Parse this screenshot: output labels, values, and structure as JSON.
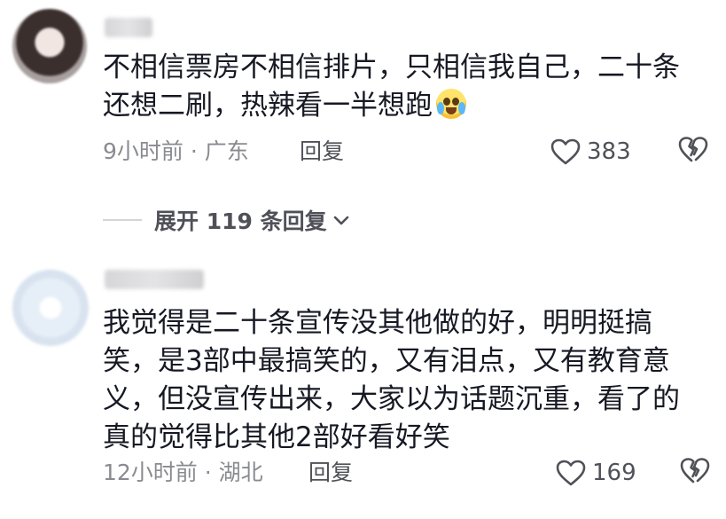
{
  "comments": [
    {
      "text": "不相信票房不相信排片，只相信我自己，二十条还想二刷，热辣看一半想跑",
      "emoji": "crying-laughing-emoji",
      "time_location": "9小时前 · 广东",
      "reply_label": "回复",
      "likes": "383",
      "expand_replies": "展开 119 条回复"
    },
    {
      "text": "我觉得是二十条宣传没其他做的好，明明挺搞笑，是3部中最搞笑的，又有泪点，又有教育意义，但没宣传出来，大家以为话题沉重，看了的真的觉得比其他2部好看好笑",
      "time_location": "12小时前 · 湖北",
      "reply_label": "回复",
      "likes": "169"
    }
  ],
  "icons": {
    "like": "heart-outline-icon",
    "dislike": "broken-heart-icon",
    "expand": "chevron-down-icon"
  },
  "colors": {
    "text": "#161823",
    "meta": "#8a8b91",
    "action": "#505158"
  }
}
